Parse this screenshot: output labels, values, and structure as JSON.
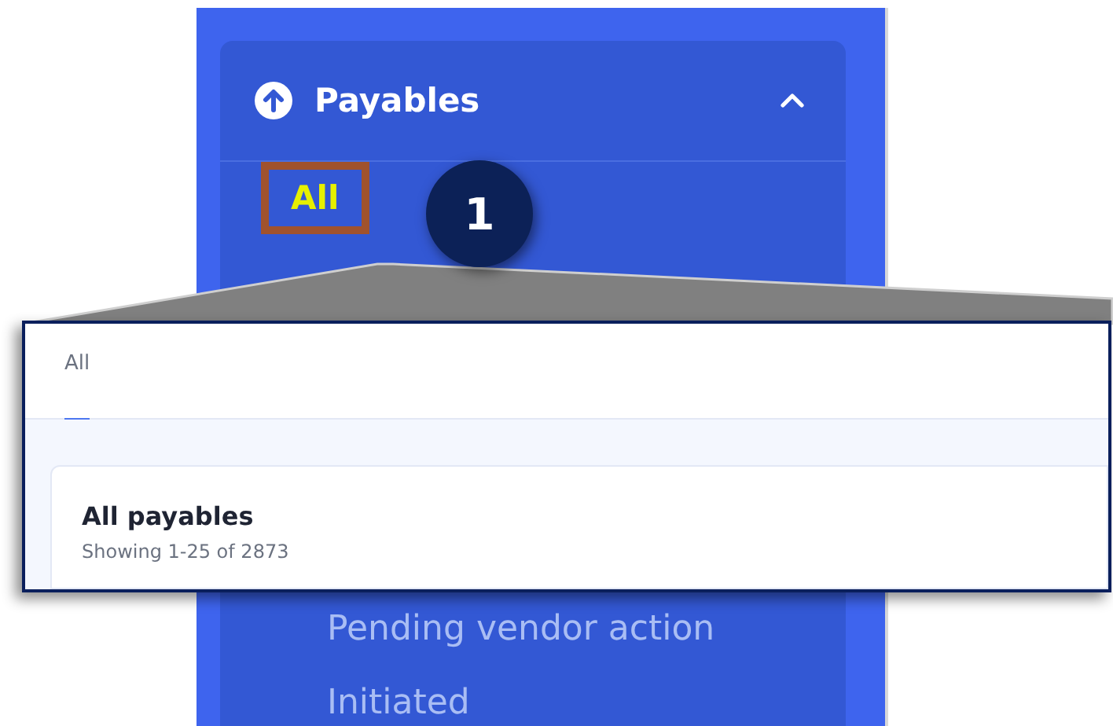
{
  "sidebar": {
    "section": {
      "title": "Payables",
      "expanded": true
    },
    "items": [
      {
        "label": "All",
        "selected": true
      },
      {
        "label": "Pending vendor action",
        "selected": false
      },
      {
        "label": "Initiated",
        "selected": false
      }
    ]
  },
  "step_badge": "1",
  "callout": {
    "tabs": [
      {
        "label": "All",
        "selected": true
      }
    ],
    "card": {
      "title": "All payables",
      "subtitle": "Showing 1-25 of 2873"
    }
  }
}
